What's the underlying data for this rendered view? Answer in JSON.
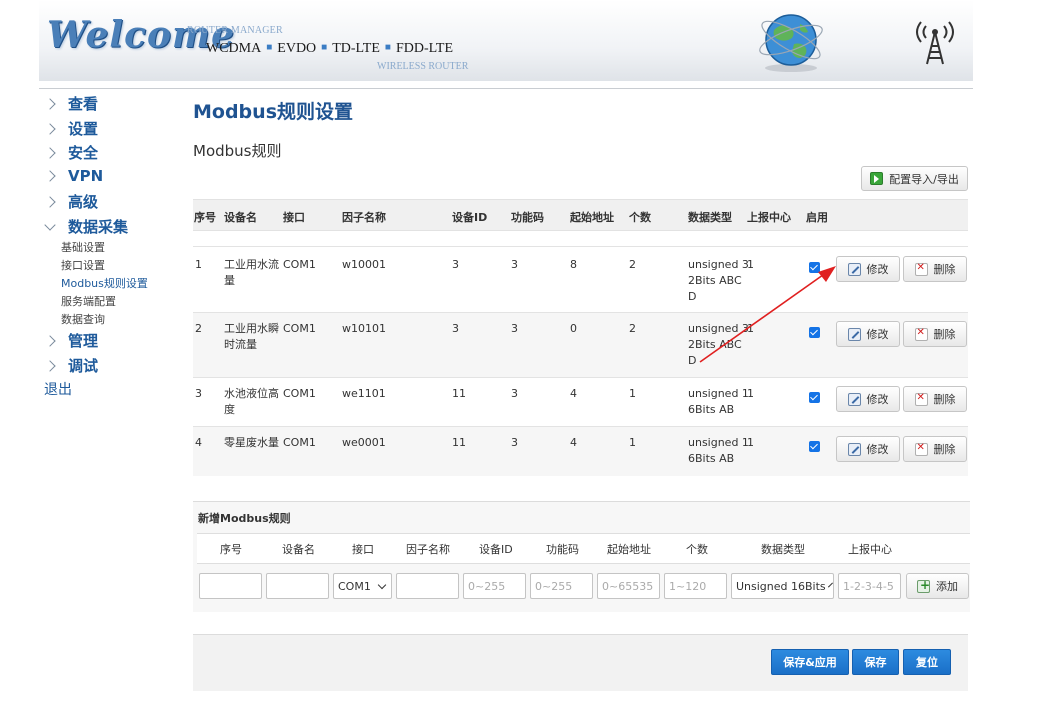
{
  "header": {
    "logo_text": "Welcome",
    "manager_text": "ROUTER MANAGER",
    "standards": [
      "WCDMA",
      "EVDO",
      "TD-LTE",
      "FDD-LTE"
    ],
    "wireless_text": "WIRELESS ROUTER"
  },
  "sidebar": {
    "items": [
      {
        "label": "查看"
      },
      {
        "label": "设置"
      },
      {
        "label": "安全"
      },
      {
        "label": "VPN"
      },
      {
        "label": "高级"
      },
      {
        "label": "数据采集"
      },
      {
        "label": "管理"
      },
      {
        "label": "调试"
      }
    ],
    "subitems": [
      {
        "label": "基础设置"
      },
      {
        "label": "接口设置"
      },
      {
        "label": "Modbus规则设置"
      },
      {
        "label": "服务端配置"
      },
      {
        "label": "数据查询"
      }
    ],
    "logout": "退出"
  },
  "main": {
    "page_title": "Modbus规则设置",
    "section_title": "Modbus规则",
    "import_export_label": "配置导入/导出",
    "columns": [
      "序号",
      "设备名",
      "接口",
      "因子名称",
      "设备ID",
      "功能码",
      "起始地址",
      "个数",
      "数据类型",
      "上报中心",
      "启用"
    ],
    "rows": [
      {
        "no": "1",
        "device_lines": [
          "工业用水流",
          "量"
        ],
        "iface": "COM1",
        "factor": "w10001",
        "device_id": "3",
        "func": "3",
        "start": "8",
        "count": "2",
        "type_lines": [
          "unsigned 3",
          "2Bits ABC",
          "D"
        ],
        "center": "1"
      },
      {
        "no": "2",
        "device_lines": [
          "工业用水瞬",
          "时流量"
        ],
        "iface": "COM1",
        "factor": "w10101",
        "device_id": "3",
        "func": "3",
        "start": "0",
        "count": "2",
        "type_lines": [
          "unsigned 3",
          "2Bits ABC",
          "D"
        ],
        "center": "1"
      },
      {
        "no": "3",
        "device_lines": [
          "水池液位高",
          "度"
        ],
        "iface": "COM1",
        "factor": "we1101",
        "device_id": "11",
        "func": "3",
        "start": "4",
        "count": "1",
        "type_lines": [
          "unsigned 1",
          "6Bits AB"
        ],
        "center": "1"
      },
      {
        "no": "4",
        "device_lines": [
          "零星废水量"
        ],
        "iface": "COM1",
        "factor": "we0001",
        "device_id": "11",
        "func": "3",
        "start": "4",
        "count": "1",
        "type_lines": [
          "unsigned 1",
          "6Bits AB"
        ],
        "center": "1"
      }
    ],
    "edit_label": "修改",
    "delete_label": "删除"
  },
  "add_form": {
    "title": "新增Modbus规则",
    "columns": [
      "序号",
      "设备名",
      "接口",
      "因子名称",
      "设备ID",
      "功能码",
      "起始地址",
      "个数",
      "数据类型",
      "上报中心"
    ],
    "iface_value": "COM1",
    "device_id_placeholder": "0~255",
    "func_placeholder": "0~255",
    "start_placeholder": "0~65535",
    "count_placeholder": "1~120",
    "type_value": "Unsigned 16Bits",
    "center_placeholder": "1-2-3-4-5",
    "add_label": "添加"
  },
  "footer": {
    "save_apply_label": "保存&应用",
    "save_label": "保存",
    "reset_label": "复位"
  },
  "colors": {
    "accent": "#1e5a9b",
    "primary_button": "#1a6fc7",
    "checkbox": "#1473e6",
    "annotation_arrow": "#e02020"
  }
}
